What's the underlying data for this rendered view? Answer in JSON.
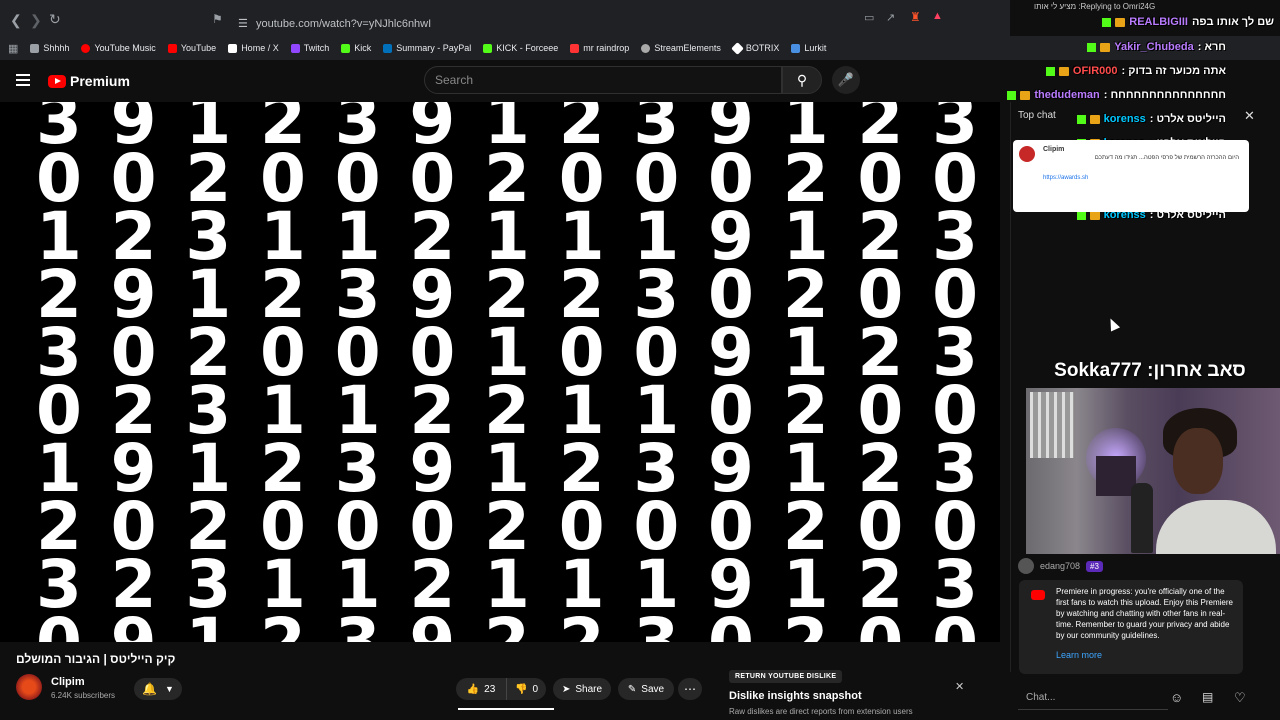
{
  "browser": {
    "url": "youtube.com/watch?v=yNJhlc6nhwI",
    "bookmarks": [
      {
        "label": "Shhhh",
        "color": "#9aa0a6"
      },
      {
        "label": "YouTube Music",
        "color": "#ff0000"
      },
      {
        "label": "YouTube",
        "color": "#ff0000"
      },
      {
        "label": "Home / X",
        "color": "#ffffff"
      },
      {
        "label": "Twitch",
        "color": "#9146ff"
      },
      {
        "label": "Kick",
        "color": "#53fc18"
      },
      {
        "label": "Summary - PayPal",
        "color": "#0070ba"
      },
      {
        "label": "KICK - Forceee",
        "color": "#53fc18"
      },
      {
        "label": "mr raindrop",
        "color": "#ff3333"
      },
      {
        "label": "StreamElements",
        "color": "#aaaaaa"
      },
      {
        "label": "BOTRIX",
        "color": "#ffffff"
      },
      {
        "label": "Lurkit",
        "color": "#4a90e2"
      }
    ]
  },
  "youtube": {
    "logo_text": "Premium",
    "search_placeholder": "Search",
    "video": {
      "digit_columns": [
        "3\n0\n1\n2\n3\n0\n1\n2\n3\n0",
        "9\n0\n2\n9\n0\n2\n9\n0\n2\n9",
        "1\n2\n3\n1\n2\n3\n1\n2\n3\n1",
        "2\n0\n1\n2\n0\n1\n2\n0\n1\n2",
        "3\n0\n1\n3\n0\n1\n3\n0\n1\n3",
        "9\n0\n2\n9\n0\n2\n9\n0\n2\n9",
        "1\n2\n1\n2\n1\n2\n1\n2\n1\n2",
        "2\n0\n1\n2\n0\n1\n2\n0\n1\n2",
        "3\n0\n1\n3\n0\n1\n3\n0\n1\n3",
        "9\n0\n9\n0\n9\n0\n9\n0\n9\n0",
        "1\n2\n1\n2\n1\n2\n1\n2\n1\n2",
        "2\n0\n2\n0\n2\n0\n2\n0\n2\n0",
        "3\n0\n3\n0\n3\n0\n3\n0\n3\n0"
      ],
      "title": "קיק הייליטס | הגיבור המושלם",
      "channel": "Clipim",
      "subscribers": "6.24K subscribers",
      "likes": "23",
      "dislikes": "0",
      "share_label": "Share",
      "save_label": "Save"
    },
    "ryd": {
      "badge": "RETURN YOUTUBE DISLIKE",
      "title": "Dislike insights snapshot",
      "subtitle": "Raw dislikes are direct reports from extension users"
    },
    "chat": {
      "header": "Top chat",
      "user": "edang708",
      "rank": "#3",
      "premiere_text": "Premiere in progress: you're officially one of the first fans to watch this upload. Enjoy this Premiere by watching and chatting with other fans in real-time. Remember to guard your privacy and abide by our community guidelines.",
      "learn_more": "Learn more",
      "input_placeholder": "Chat..."
    }
  },
  "stream_overlay": {
    "reply_text": "Replying to Omri24G: מציע לי אותו",
    "lines": [
      {
        "nick": "REALBIGIII",
        "msg": "שם לך אותו בפה",
        "color": "purple"
      },
      {
        "nick": "Yakir_Chubeda",
        "msg": ": חרא",
        "color": "purple"
      },
      {
        "nick": "OFIR000",
        "msg": ": אתה מכוער זה בדוק",
        "color": "red"
      },
      {
        "nick": "thedudeman",
        "msg": ": חחחחחחחחחחחחחחח",
        "color": "purple"
      },
      {
        "nick": "korenss",
        "msg": ": הייליטס אלרט",
        "color": "blue"
      },
      {
        "nick": "korenss",
        "msg": ": הייליטס אלרט",
        "color": "blue"
      },
      {
        "nick": "korenss",
        "msg": ": הייליטס אלרט",
        "color": "blue"
      },
      {
        "nick": "korenss",
        "msg": ": הייליטס אלרט",
        "color": "blue"
      },
      {
        "nick": "korenss",
        "msg": ": הייליטס אלרט",
        "color": "blue"
      }
    ],
    "popup_nick": "Clipim",
    "popup_text": "היום ההכרזה הרשמית של פרסי הפטה... תגידו מה דעתכם",
    "popup_link": "https://awards.sh",
    "last_sub": "סאב אחרון: Sokka777"
  }
}
